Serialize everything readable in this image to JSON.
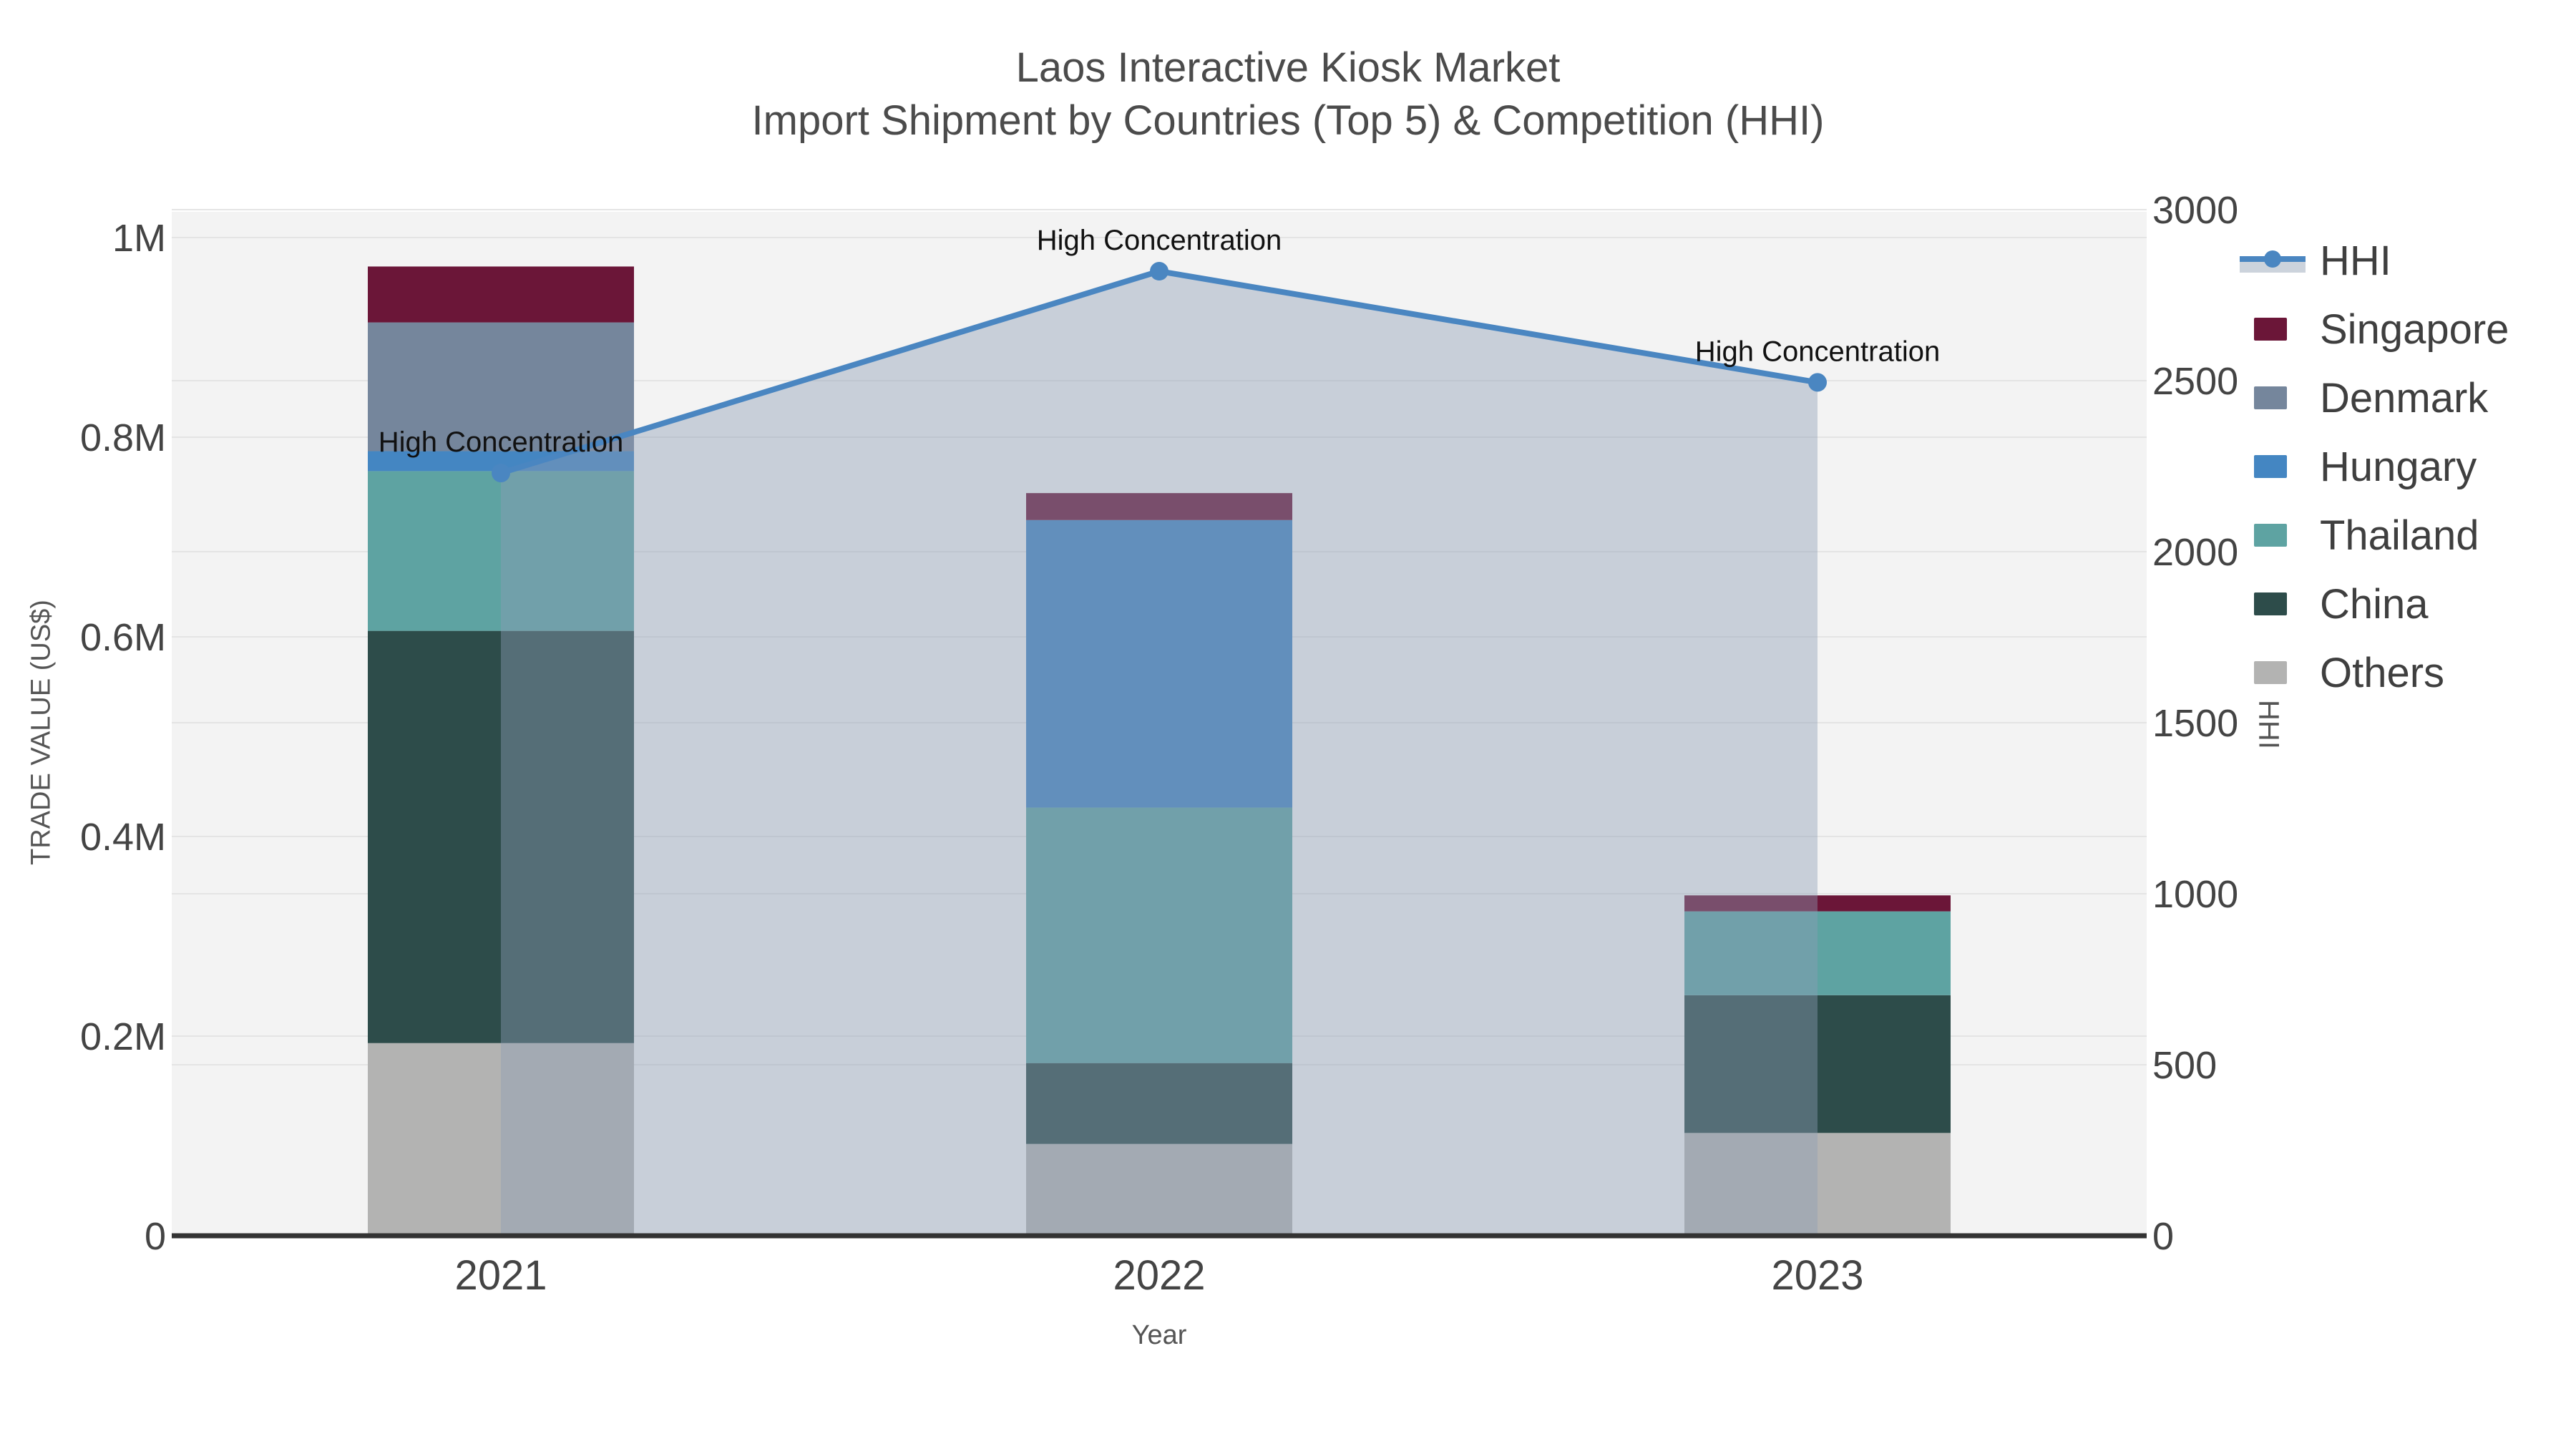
{
  "title": {
    "line1": "Laos Interactive Kiosk Market",
    "line2": "Import Shipment by Countries (Top 5) & Competition (HHI)"
  },
  "axes": {
    "x": {
      "title": "Year",
      "ticks": [
        "2021",
        "2022",
        "2023"
      ]
    },
    "y_left": {
      "title": "TRADE VALUE (US$)",
      "ticks": [
        "0",
        "0.2M",
        "0.4M",
        "0.6M",
        "0.8M",
        "1M"
      ],
      "tick_values": [
        0,
        200000,
        400000,
        600000,
        800000,
        1000000
      ],
      "max": 1000000
    },
    "y_right": {
      "title": "HHI",
      "ticks": [
        "0",
        "500",
        "1000",
        "1500",
        "2000",
        "2500",
        "3000"
      ],
      "tick_values": [
        0,
        500,
        1000,
        1500,
        2000,
        2500,
        3000
      ],
      "max": 3000
    }
  },
  "legend": [
    {
      "label": "HHI",
      "type": "line-area",
      "color": "#4a86c1"
    },
    {
      "label": "Singapore",
      "type": "swatch",
      "color": "#6b1638"
    },
    {
      "label": "Denmark",
      "type": "swatch",
      "color": "#75869c"
    },
    {
      "label": "Hungary",
      "type": "swatch",
      "color": "#4486c2"
    },
    {
      "label": "Thailand",
      "type": "swatch",
      "color": "#5ea3a2"
    },
    {
      "label": "China",
      "type": "swatch",
      "color": "#2d4c4a"
    },
    {
      "label": "Others",
      "type": "swatch",
      "color": "#b3b3b2"
    }
  ],
  "chart_data": {
    "type": "bar",
    "subtype": "stacked-bars-with-line-overlay",
    "title": "Laos Interactive Kiosk Market Import Shipment by Countries (Top 5) & Competition (HHI)",
    "xlabel": "Year",
    "ylabel_left": "TRADE VALUE (US$)",
    "ylabel_right": "HHI",
    "ylim_left": [
      0,
      1000000
    ],
    "ylim_right": [
      0,
      3000
    ],
    "grid": true,
    "legend_position": "right",
    "categories": [
      "2021",
      "2022",
      "2023"
    ],
    "bar_series": [
      {
        "name": "Others",
        "color": "#b3b3b2",
        "values": [
          193000,
          92000,
          103000
        ]
      },
      {
        "name": "China",
        "color": "#2d4c4a",
        "values": [
          413000,
          81000,
          138000
        ]
      },
      {
        "name": "Thailand",
        "color": "#5ea3a2",
        "values": [
          160000,
          256000,
          84000
        ]
      },
      {
        "name": "Hungary",
        "color": "#4486c2",
        "values": [
          20000,
          288000,
          0
        ]
      },
      {
        "name": "Denmark",
        "color": "#75869c",
        "values": [
          129000,
          0,
          0
        ]
      },
      {
        "name": "Singapore",
        "color": "#6b1638",
        "values": [
          56000,
          27000,
          16000
        ]
      }
    ],
    "line_series": {
      "name": "HHI",
      "axis": "right",
      "color": "#4a86c1",
      "fill_color": "rgba(141,157,182,0.42)",
      "values": [
        2230,
        2820,
        2495
      ]
    },
    "annotations": [
      {
        "text": "High Concentration",
        "category": "2021",
        "value": 2230
      },
      {
        "text": "High Concentration",
        "category": "2022",
        "value": 2820
      },
      {
        "text": "High Concentration",
        "category": "2023",
        "value": 2495
      }
    ],
    "colors": {
      "plot_background": "#f3f3f3",
      "gridline": "#e4e4e4",
      "axis_line": "#333333",
      "tick_text": "#444444",
      "annotation_text": "#111111"
    }
  }
}
